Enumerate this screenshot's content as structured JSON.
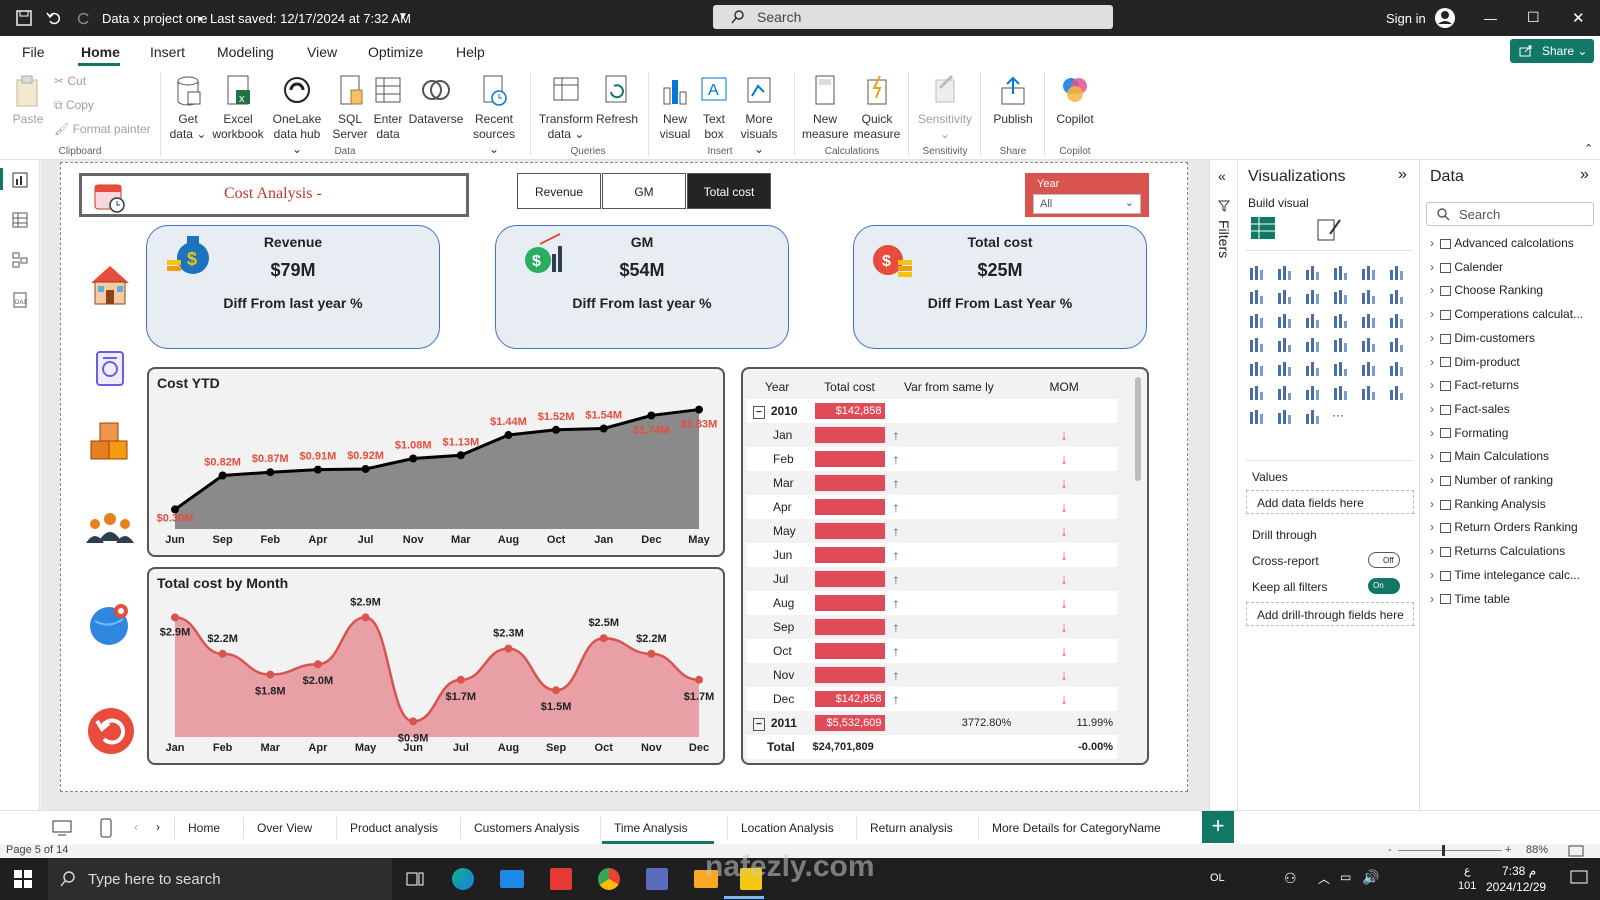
{
  "titlebar": {
    "doc_title": "Data x project one",
    "saved": "Last saved: 12/17/2024 at 7:32 AM",
    "search_placeholder": "Search",
    "signin": "Sign in"
  },
  "menu": {
    "items": [
      "File",
      "Home",
      "Insert",
      "Modeling",
      "View",
      "Optimize",
      "Help"
    ],
    "active": "Home",
    "share": "Share"
  },
  "ribbon": {
    "clipboard": {
      "paste": "Paste",
      "cut": "Cut",
      "copy": "Copy",
      "format_painter": "Format painter",
      "group": "Clipboard"
    },
    "data": {
      "items": [
        "Get data",
        "Excel workbook",
        "OneLake data hub",
        "SQL Server",
        "Enter data",
        "Dataverse",
        "Recent sources"
      ],
      "group": "Data"
    },
    "queries": {
      "items": [
        "Transform data",
        "Refresh"
      ],
      "group": "Queries"
    },
    "insert": {
      "items": [
        "New visual",
        "Text box",
        "More visuals"
      ],
      "group": "Insert"
    },
    "calculations": {
      "items": [
        "New measure",
        "Quick measure"
      ],
      "group": "Calculations"
    },
    "sensitivity": {
      "items": [
        "Sensitivity"
      ],
      "group": "Sensitivity"
    },
    "share": {
      "items": [
        "Publish"
      ],
      "group": "Share"
    },
    "copilot": {
      "items": [
        "Copilot"
      ],
      "group": "Copilot"
    }
  },
  "report": {
    "title": "Cost Analysis -",
    "toggles": [
      "Revenue",
      "GM",
      "Total cost"
    ],
    "active_toggle": "Total cost",
    "slicer": {
      "label": "Year",
      "value": "All"
    },
    "kpis": [
      {
        "title": "Revenue",
        "value": "$79M",
        "diff": "Diff From last year %"
      },
      {
        "title": "GM",
        "value": "$54M",
        "diff": "Diff From last year %"
      },
      {
        "title": "Total cost",
        "value": "$25M",
        "diff": "Diff From Last Year %"
      }
    ],
    "matrix": {
      "headers": [
        "Year",
        "Total cost",
        "Var from same ly",
        "MOM"
      ],
      "rows": [
        {
          "label": "2010",
          "cost": "$142,858",
          "var": "",
          "mom": "",
          "level": 0
        },
        {
          "label": "Jan",
          "cost": "",
          "var": "up",
          "mom": "down",
          "level": 1
        },
        {
          "label": "Feb",
          "cost": "",
          "var": "up",
          "mom": "down",
          "level": 1
        },
        {
          "label": "Mar",
          "cost": "",
          "var": "up",
          "mom": "down",
          "level": 1
        },
        {
          "label": "Apr",
          "cost": "",
          "var": "up",
          "mom": "down",
          "level": 1
        },
        {
          "label": "May",
          "cost": "",
          "var": "up",
          "mom": "down",
          "level": 1
        },
        {
          "label": "Jun",
          "cost": "",
          "var": "up",
          "mom": "down",
          "level": 1
        },
        {
          "label": "Jul",
          "cost": "",
          "var": "up",
          "mom": "down",
          "level": 1
        },
        {
          "label": "Aug",
          "cost": "",
          "var": "up",
          "mom": "down",
          "level": 1
        },
        {
          "label": "Sep",
          "cost": "",
          "var": "up",
          "mom": "down",
          "level": 1
        },
        {
          "label": "Oct",
          "cost": "",
          "var": "up",
          "mom": "down",
          "level": 1
        },
        {
          "label": "Nov",
          "cost": "",
          "var": "up",
          "mom": "down",
          "level": 1
        },
        {
          "label": "Dec",
          "cost": "$142,858",
          "var": "up",
          "mom": "down",
          "level": 1
        },
        {
          "label": "2011",
          "cost": "$5,532,609",
          "var": "3772.80%",
          "mom": "11.99%",
          "level": 0
        }
      ],
      "total": {
        "label": "Total",
        "cost": "$24,701,809",
        "var": "",
        "mom": "-0.00%"
      }
    }
  },
  "chart_data": [
    {
      "type": "area",
      "title": "Cost YTD",
      "categories": [
        "Jun",
        "Sep",
        "Feb",
        "Apr",
        "Jul",
        "Nov",
        "Mar",
        "Aug",
        "Oct",
        "Jan",
        "Dec",
        "May"
      ],
      "values": [
        0.3,
        0.82,
        0.87,
        0.91,
        0.92,
        1.08,
        1.13,
        1.44,
        1.52,
        1.54,
        1.74,
        1.83
      ],
      "labels": [
        "$0.30M",
        "$0.82M",
        "$0.87M",
        "$0.91M",
        "$0.92M",
        "$1.08M",
        "$1.13M",
        "$1.44M",
        "$1.52M",
        "$1.54M",
        "$1.74M",
        "$1.83M"
      ],
      "ylim": [
        0,
        1.9
      ]
    },
    {
      "type": "area",
      "title": "Total cost by Month",
      "categories": [
        "Jan",
        "Feb",
        "Mar",
        "Apr",
        "May",
        "Jun",
        "Jul",
        "Aug",
        "Sep",
        "Oct",
        "Nov",
        "Dec"
      ],
      "values": [
        2.9,
        2.2,
        1.8,
        2.0,
        2.9,
        0.9,
        1.7,
        2.3,
        1.5,
        2.5,
        2.2,
        1.7
      ],
      "labels": [
        "$2.9M",
        "$2.2M",
        "$1.8M",
        "$2.0M",
        "$2.9M",
        "$0.9M",
        "$1.7M",
        "$2.3M",
        "$1.5M",
        "$2.5M",
        "$2.2M",
        "$1.7M"
      ],
      "ylim": [
        0.6,
        3.1
      ]
    }
  ],
  "viz_pane": {
    "title": "Visualizations",
    "build_visual": "Build visual",
    "filters": "Filters",
    "values_label": "Values",
    "values_placeholder": "Add data fields here",
    "drill_through": "Drill through",
    "cross_report": "Cross-report",
    "cross_report_state": "Off",
    "keep_filters": "Keep all filters",
    "keep_filters_state": "On",
    "drill_placeholder": "Add drill-through fields here"
  },
  "data_pane": {
    "title": "Data",
    "search_placeholder": "Search",
    "fields": [
      "Advanced calcolations",
      "Calender",
      "Choose Ranking",
      "Comperations calculat...",
      "Dim-customers",
      "Dim-product",
      "Fact-returns",
      "Fact-sales",
      "Formating",
      "Main Calculations",
      "Number of ranking",
      "Ranking Analysis",
      "Return Orders Ranking",
      "Returns Calculations",
      "Time intelegance calc...",
      "Time table"
    ]
  },
  "tabs": {
    "items": [
      "Home",
      "Over View",
      "Product analysis",
      "Customers Analysis",
      "Time Analysis",
      "Location Analysis",
      "Return analysis",
      "More Details for CategoryName"
    ],
    "active": "Time Analysis"
  },
  "status": {
    "page": "Page 5 of 14",
    "zoom": "88%"
  },
  "taskbar": {
    "search": "Type here to search",
    "time": "7:38 م",
    "date": "2024/12/29",
    "lang": "ع",
    "num": "101",
    "ol": "OL"
  },
  "watermark": "nafezly.com"
}
